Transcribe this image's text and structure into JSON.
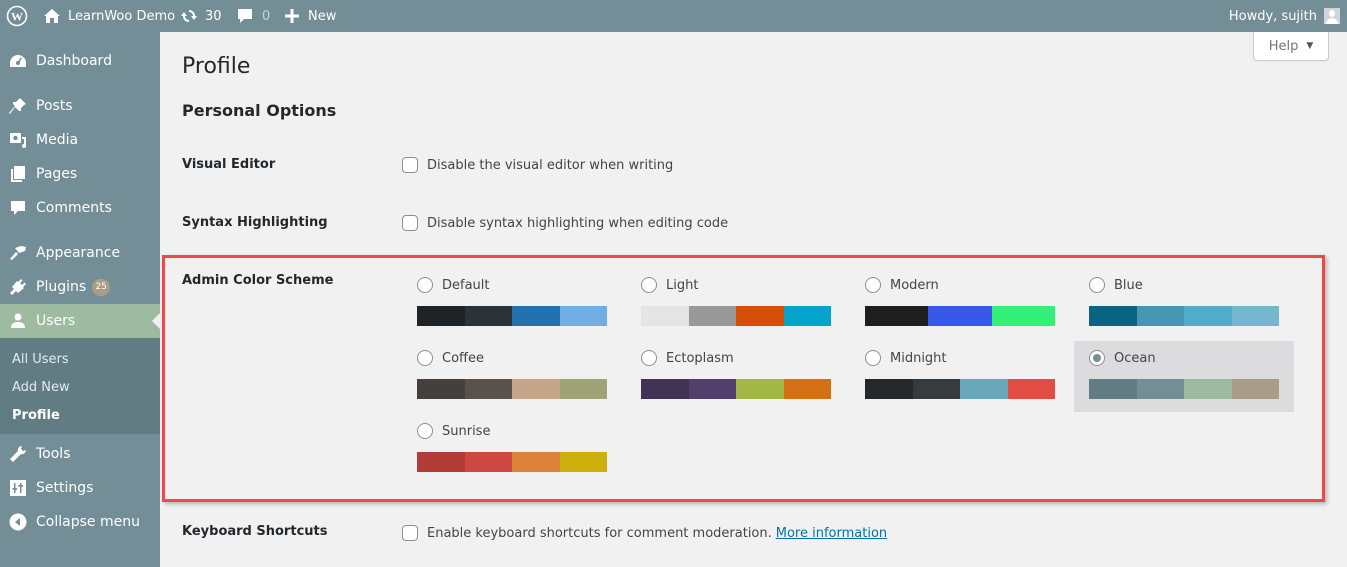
{
  "adminbar": {
    "site_name": "LearnWoo Demo",
    "updates_count": "30",
    "comments_count": "0",
    "new_label": "New",
    "greeting": "Howdy, sujith"
  },
  "sidebar": {
    "items": [
      {
        "label": "Dashboard",
        "icon": "dashboard-icon"
      },
      {
        "label": "Posts",
        "icon": "pin-icon"
      },
      {
        "label": "Media",
        "icon": "media-icon"
      },
      {
        "label": "Pages",
        "icon": "pages-icon"
      },
      {
        "label": "Comments",
        "icon": "comment-icon"
      },
      {
        "label": "Appearance",
        "icon": "brush-icon"
      },
      {
        "label": "Plugins",
        "icon": "plugin-icon",
        "badge": "25"
      },
      {
        "label": "Users",
        "icon": "user-icon",
        "active": true
      },
      {
        "label": "Tools",
        "icon": "wrench-icon"
      },
      {
        "label": "Settings",
        "icon": "settings-icon"
      },
      {
        "label": "Collapse menu",
        "icon": "collapse-icon"
      }
    ],
    "submenu": [
      {
        "label": "All Users"
      },
      {
        "label": "Add New"
      },
      {
        "label": "Profile",
        "current": true
      }
    ]
  },
  "help_label": "Help",
  "page": {
    "title": "Profile",
    "section_title": "Personal Options",
    "visual_editor": {
      "label": "Visual Editor",
      "option": "Disable the visual editor when writing",
      "checked": false
    },
    "syntax_highlighting": {
      "label": "Syntax Highlighting",
      "option": "Disable syntax highlighting when editing code",
      "checked": false
    },
    "color_scheme": {
      "label": "Admin Color Scheme",
      "selected": "Ocean",
      "schemes": [
        {
          "name": "Default",
          "colors": [
            "#1d2327",
            "#2c3338",
            "#2271b1",
            "#72aee6"
          ]
        },
        {
          "name": "Light",
          "colors": [
            "#e5e5e5",
            "#999999",
            "#d64e07",
            "#04a4cc"
          ]
        },
        {
          "name": "Modern",
          "colors": [
            "#1e1e1e",
            "#3858e9",
            "#33f078"
          ]
        },
        {
          "name": "Blue",
          "colors": [
            "#096484",
            "#4796b3",
            "#52accc",
            "#74b6ce"
          ]
        },
        {
          "name": "Coffee",
          "colors": [
            "#46403c",
            "#59524c",
            "#c7a589",
            "#9ea476"
          ]
        },
        {
          "name": "Ectoplasm",
          "colors": [
            "#413256",
            "#523f6d",
            "#a3b745",
            "#d46f15"
          ]
        },
        {
          "name": "Midnight",
          "colors": [
            "#25282b",
            "#363b3f",
            "#69a8bb",
            "#e14d43"
          ]
        },
        {
          "name": "Ocean",
          "colors": [
            "#627c83",
            "#738e96",
            "#9ebaa0",
            "#aa9d88"
          ]
        },
        {
          "name": "Sunrise",
          "colors": [
            "#b43c38",
            "#cf4944",
            "#dd823b",
            "#ccaf0b"
          ]
        }
      ]
    },
    "keyboard_shortcuts": {
      "label": "Keyboard Shortcuts",
      "option": "Enable keyboard shortcuts for comment moderation.",
      "link": "More information",
      "checked": false
    }
  }
}
